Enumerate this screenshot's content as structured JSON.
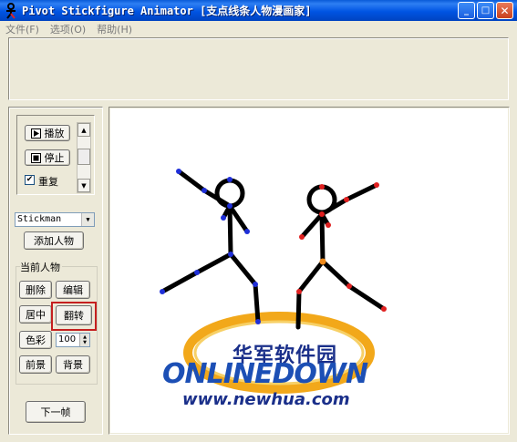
{
  "window": {
    "title": "Pivot Stickfigure Animator [支点线条人物漫画家]",
    "minimize_glyph": "_",
    "maximize_glyph": "□",
    "close_glyph": "✕"
  },
  "menu": [
    "文件(F)",
    "选项(O)",
    "帮助(H)"
  ],
  "playback": {
    "play_label": "播放",
    "stop_label": "停止",
    "repeat_label": "重复",
    "repeat_checked": true,
    "check_glyph": "✔",
    "scroll_up": "▲",
    "scroll_down": "▼"
  },
  "figure_select": {
    "value": "Stickman",
    "arrow": "▼"
  },
  "add_figure_label": "添加人物",
  "current_figure": {
    "group_label": "当前人物",
    "delete_label": "删除",
    "edit_label": "编辑",
    "center_label": "居中",
    "flip_label": "翻转",
    "color_label": "色彩",
    "color_value": "100",
    "spin_up": "▲",
    "spin_down": "▼",
    "front_label": "前景",
    "back_label": "背景"
  },
  "next_frame_label": "下一帧",
  "watermark": {
    "cn": "华军软件园",
    "en": "ONLINEDOWN",
    "url": "www.newhua.com"
  },
  "colors": {
    "title_blue": "#0054e3",
    "handle_blue": "#1f2fd8",
    "handle_red": "#e02020",
    "handle_orange": "#f08a1a",
    "highlight_red": "#c51f1f"
  }
}
